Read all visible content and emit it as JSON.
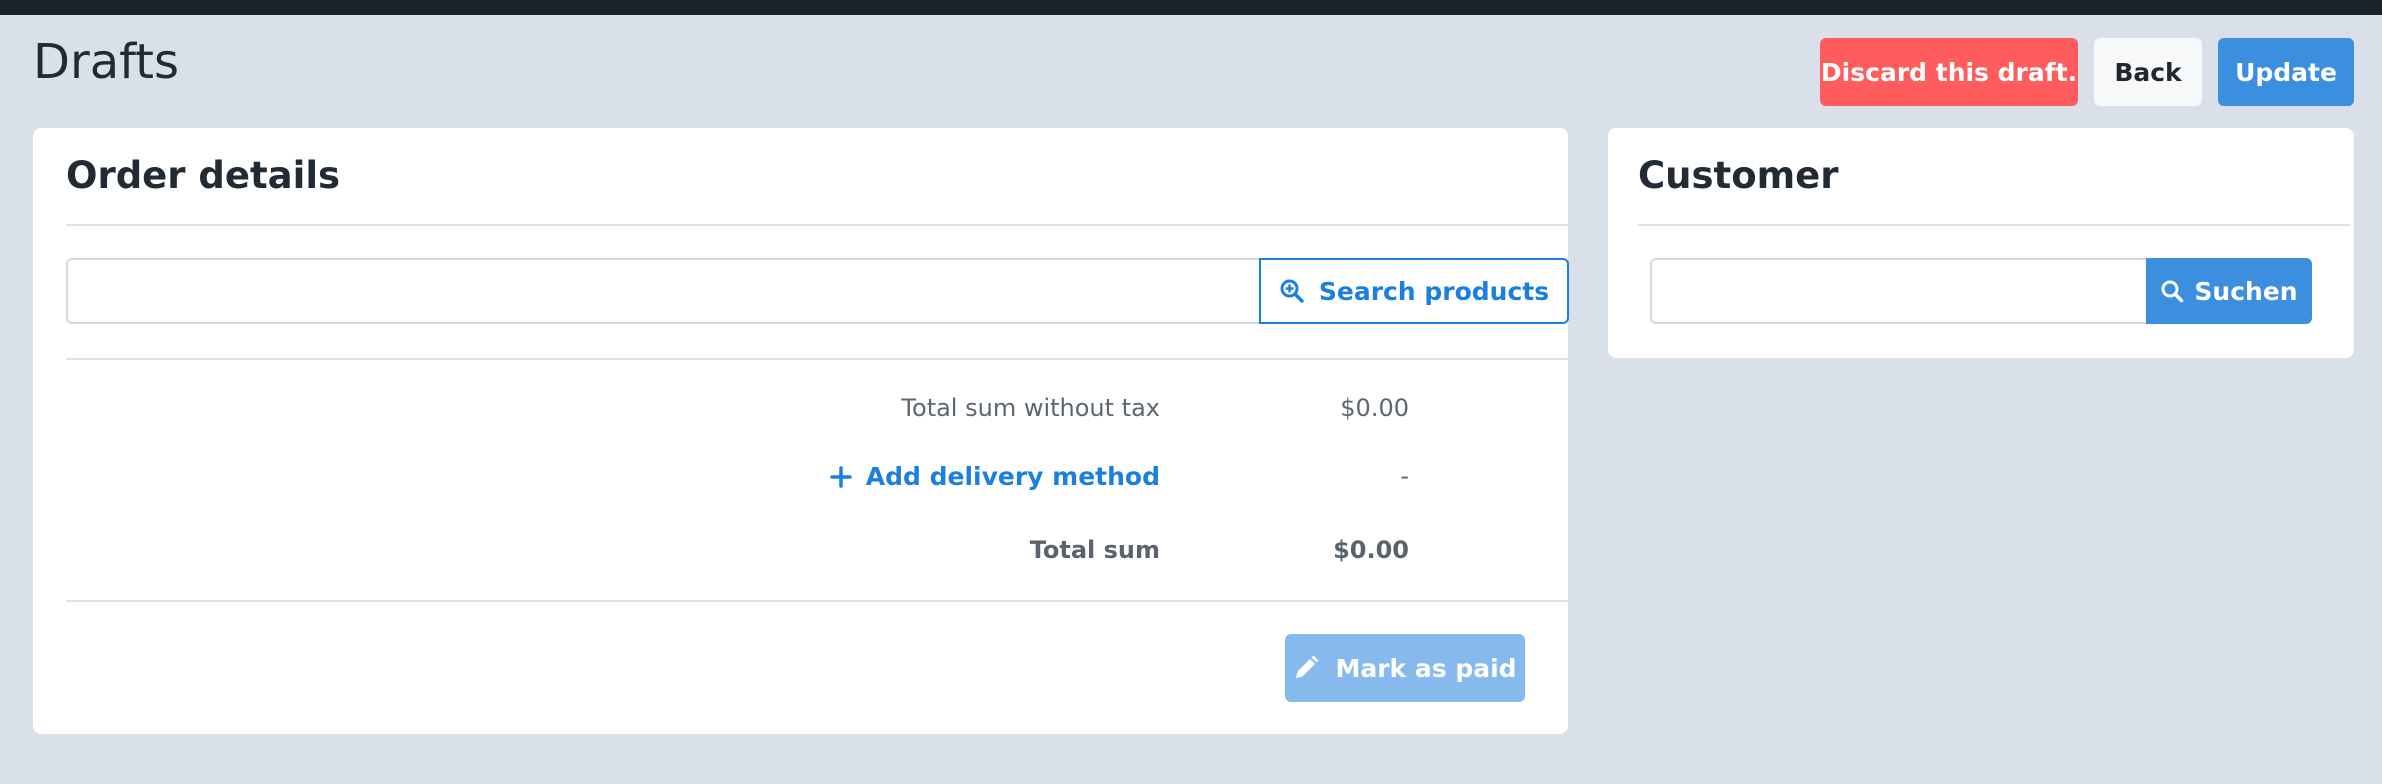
{
  "page": {
    "title": "Drafts"
  },
  "header_actions": {
    "discard_label": "Discard this draft.",
    "back_label": "Back",
    "update_label": "Update"
  },
  "order": {
    "title": "Order details",
    "search": {
      "value": "",
      "placeholder": "",
      "button_label": "Search products",
      "icon": "zoom-in-icon"
    },
    "totals": {
      "subtotal_label": "Total sum without tax",
      "subtotal_value": "$0.00",
      "delivery_label": "Add delivery method",
      "delivery_value": "-",
      "total_label": "Total sum",
      "total_value": "$0.00"
    },
    "mark_paid_label": "Mark as paid"
  },
  "customer": {
    "title": "Customer",
    "search": {
      "value": "",
      "placeholder": "",
      "button_label": "Suchen",
      "icon": "search-icon"
    }
  },
  "colors": {
    "danger": "#ff5d5d",
    "primary": "#3c8fde",
    "link": "#1b7fe0",
    "disabled_primary": "#86b9ec",
    "background": "#d9e0e9"
  }
}
